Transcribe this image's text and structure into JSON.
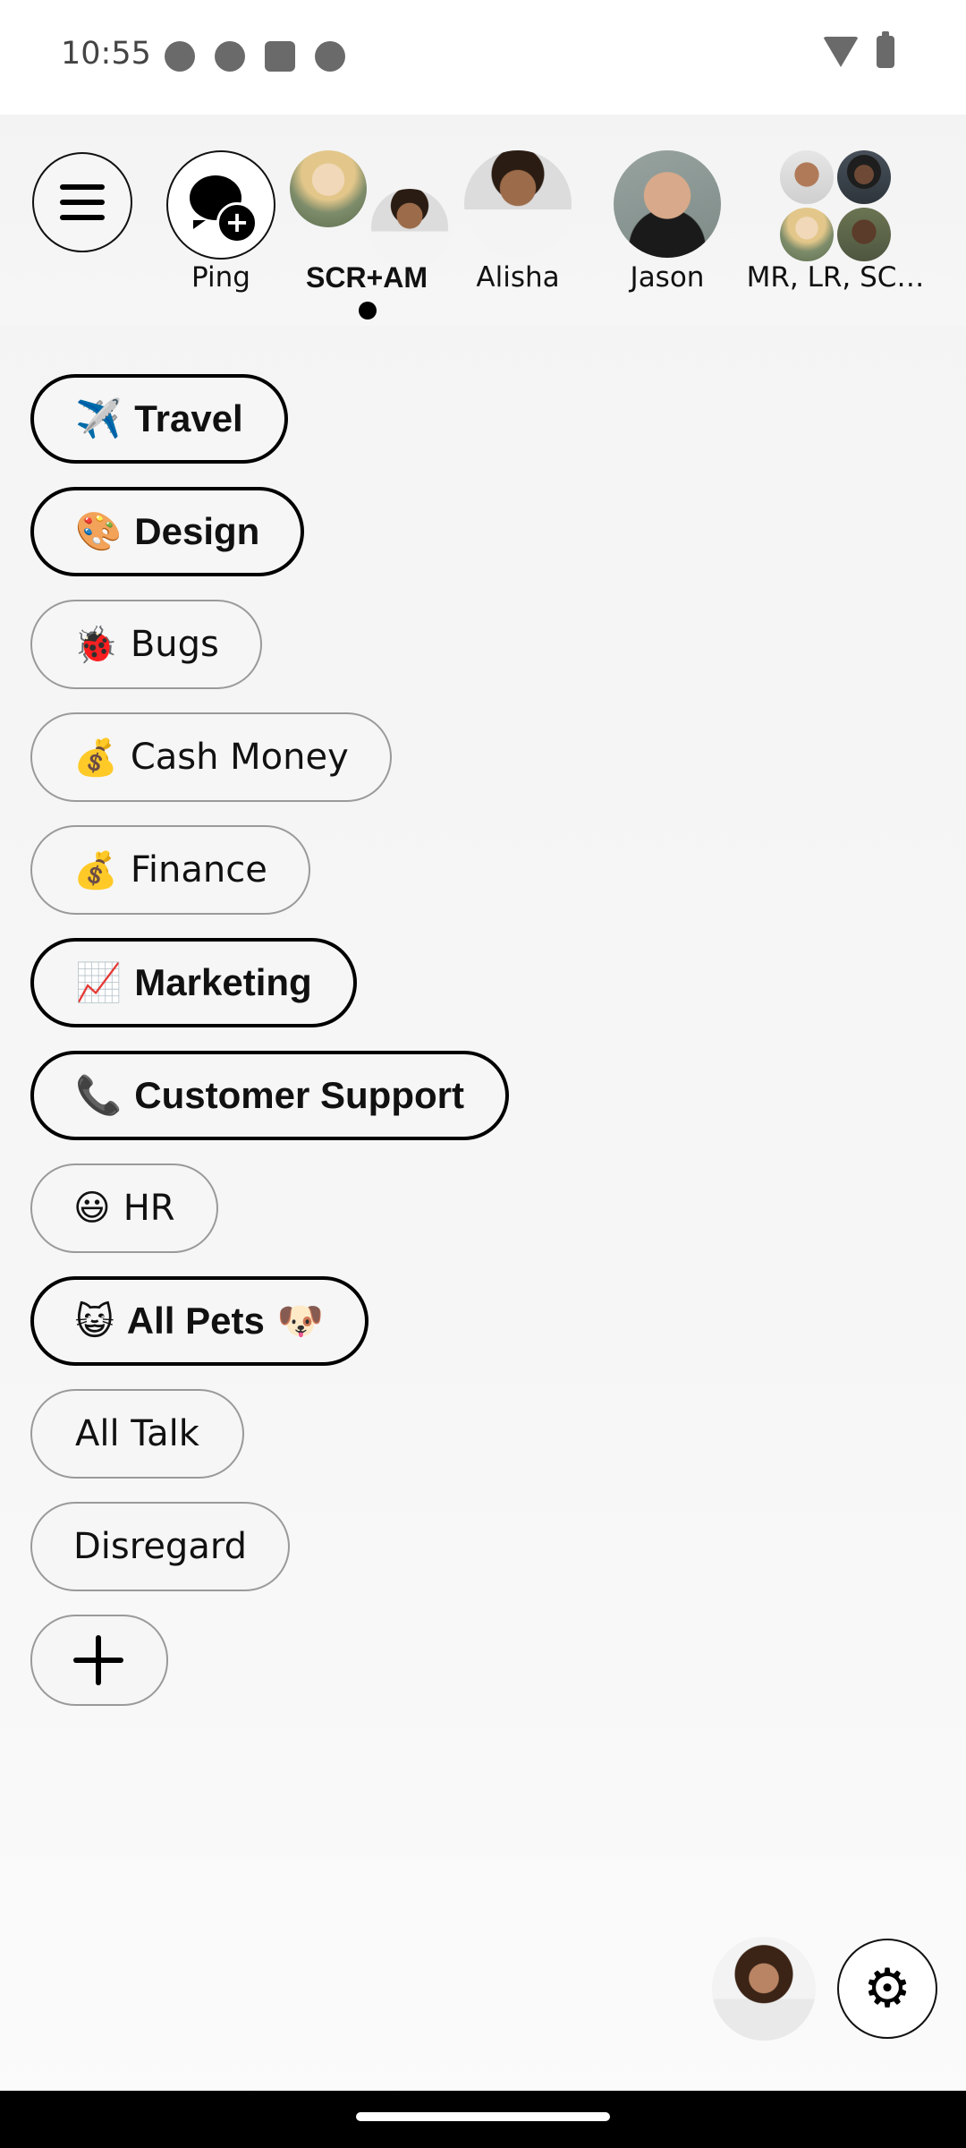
{
  "status_bar": {
    "time": "10:55",
    "left_icons": [
      "cat-face-icon",
      "chrome-icon",
      "calendar-icon",
      "activity-icon"
    ],
    "right_icons": [
      "wifi-icon",
      "battery-charging-icon"
    ]
  },
  "contacts_bar": {
    "menu_icon": "hamburger-menu-icon",
    "contacts": [
      {
        "label": "Ping",
        "type": "new-chat",
        "selected": false
      },
      {
        "label": "SCR+AM",
        "type": "group-2",
        "selected": true
      },
      {
        "label": "Alisha",
        "type": "person",
        "selected": false
      },
      {
        "label": "Jason",
        "type": "person",
        "selected": false
      },
      {
        "label": "MR, LR, SC…",
        "type": "group-4",
        "selected": false
      }
    ]
  },
  "channels": [
    {
      "emoji": "✈️",
      "label": "Travel",
      "unread": true
    },
    {
      "emoji": "🎨",
      "label": "Design",
      "unread": true
    },
    {
      "emoji": "🐞",
      "label": "Bugs",
      "unread": false
    },
    {
      "emoji": "💰",
      "label": "Cash Money",
      "unread": false
    },
    {
      "emoji": "💰",
      "label": "Finance",
      "unread": false
    },
    {
      "emoji": "📈",
      "label": "Marketing",
      "unread": true
    },
    {
      "emoji": "📞",
      "label": "Customer Support",
      "unread": true
    },
    {
      "emoji": "😃",
      "label": "HR",
      "unread": false
    },
    {
      "emoji": "😺",
      "label": "All Pets",
      "emoji_after": "🐶",
      "unread": true
    },
    {
      "emoji": "",
      "label": "All Talk",
      "unread": false
    },
    {
      "emoji": "",
      "label": "Disregard",
      "unread": false
    }
  ],
  "add_channel_icon": "plus-icon",
  "bottom": {
    "settings_icon": "gear-icon",
    "gear_glyph": "⚙"
  },
  "colors": {
    "background": "#f5f5f5",
    "text": "#111111",
    "unread_border": "#000000",
    "read_border": "#9a9a9a"
  }
}
